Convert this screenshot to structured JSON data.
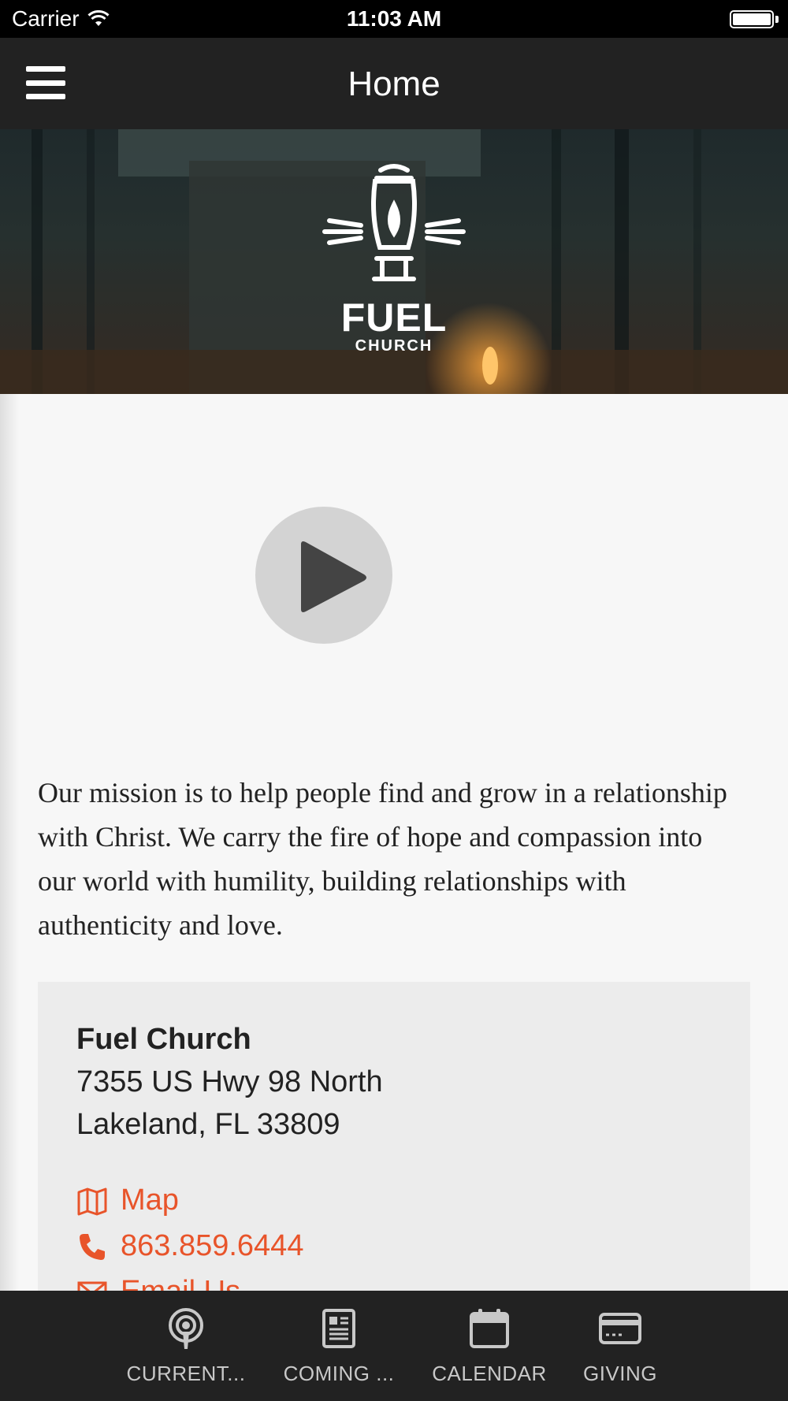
{
  "status_bar": {
    "carrier": "Carrier",
    "time": "11:03 AM"
  },
  "nav": {
    "title": "Home"
  },
  "hero": {
    "logo_fuel": "FUEL",
    "logo_church": "CHURCH"
  },
  "mission": {
    "text": "Our mission is to help people find and grow in a relationship with Christ. We carry the fire of hope and compassion into our world with humility, building relationships with authenticity and love."
  },
  "contact": {
    "name": "Fuel Church",
    "address_line1": "7355 US Hwy 98 North",
    "address_line2": "Lakeland, FL 33809",
    "map_label": "Map",
    "phone": "863.859.6444",
    "email_label": "Email Us"
  },
  "tabs": [
    {
      "label": "CURRENT...",
      "icon": "podcast-icon"
    },
    {
      "label": "COMING ...",
      "icon": "newspaper-icon"
    },
    {
      "label": "CALENDAR",
      "icon": "calendar-icon"
    },
    {
      "label": "GIVING",
      "icon": "credit-card-icon"
    }
  ],
  "colors": {
    "accent": "#e8542a",
    "nav_background": "#222222",
    "card_background": "#ececec"
  }
}
